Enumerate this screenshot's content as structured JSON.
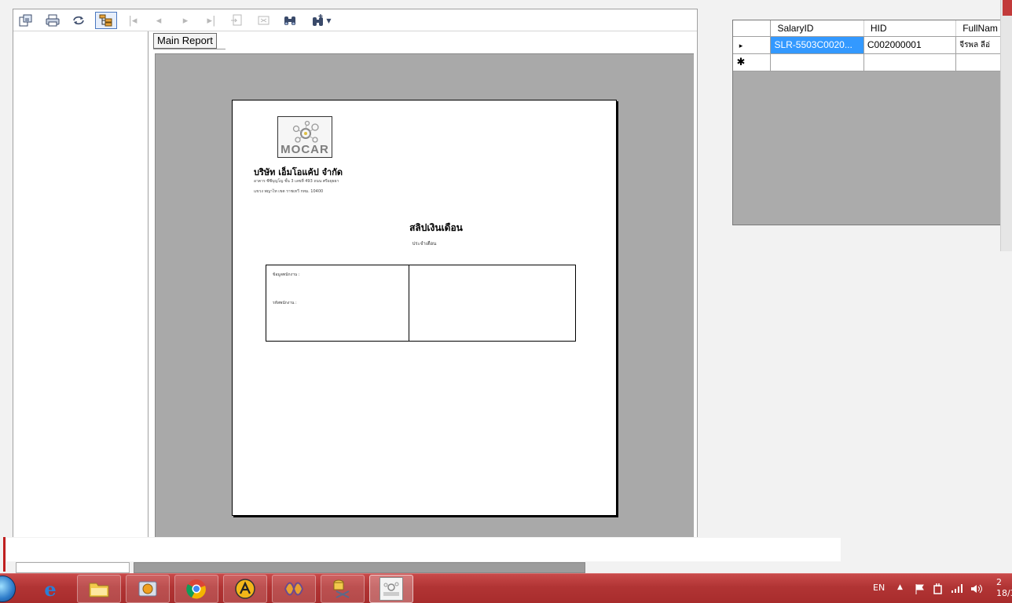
{
  "toolbar": {
    "buttons": [
      {
        "name": "export",
        "icon": "export-icon",
        "enabled": true
      },
      {
        "name": "print",
        "icon": "printer-icon",
        "enabled": true
      },
      {
        "name": "refresh",
        "icon": "refresh-icon",
        "enabled": true
      },
      {
        "name": "toggle-group-tree",
        "icon": "group-tree-icon",
        "enabled": true,
        "active": true
      },
      {
        "name": "first-page",
        "icon": "first-page-icon",
        "enabled": false
      },
      {
        "name": "previous-page",
        "icon": "previous-page-icon",
        "enabled": false
      },
      {
        "name": "next-page",
        "icon": "next-page-icon",
        "enabled": false
      },
      {
        "name": "last-page",
        "icon": "last-page-icon",
        "enabled": false
      },
      {
        "name": "goto-page",
        "icon": "goto-page-icon",
        "enabled": false
      },
      {
        "name": "close-view",
        "icon": "close-view-icon",
        "enabled": false
      },
      {
        "name": "find",
        "icon": "binoculars-icon",
        "enabled": true
      },
      {
        "name": "zoom",
        "icon": "zoom-icon",
        "enabled": true
      }
    ]
  },
  "report": {
    "tab_label": "Main Report",
    "logo_text": "MOCAR",
    "company_name": "บริษัท เอ็มโอแค้ป จำกัด",
    "address_line1": "อาคาร ซีซีบุญโญ ชั้น 3 เลขที่ 493 ถนน ศรีอยุธยา",
    "address_line2": "แขวง พญาไท เขต ราชเทวี กทม. 10400",
    "slip_title": "สลิปเงินเดือน",
    "slip_subtitle": "ประจำเดือน",
    "employee_info_label": "ข้อมูลพนักงาน :",
    "employee_code_label": "รหัสพนักงาน :"
  },
  "grid": {
    "columns": [
      "SalaryID",
      "HID",
      "FullNam"
    ],
    "rows": [
      {
        "marker": "▸",
        "SalaryID": "SLR-5503C0020...",
        "HID": "C002000001",
        "FullName": "จีรพล ลีอ่"
      }
    ],
    "new_row_marker": "✱"
  },
  "taskbar": {
    "items": [
      {
        "name": "internet-explorer",
        "icon": "internet-explorer-icon"
      },
      {
        "name": "file-explorer",
        "icon": "folder-icon"
      },
      {
        "name": "media-player",
        "icon": "media-player-icon"
      },
      {
        "name": "chrome",
        "icon": "chrome-icon"
      },
      {
        "name": "app-a",
        "icon": "circle-a-icon"
      },
      {
        "name": "visual-studio",
        "icon": "visual-studio-icon"
      },
      {
        "name": "database-tool",
        "icon": "database-tool-icon"
      },
      {
        "name": "mocar-app",
        "icon": "mocar-app-icon"
      }
    ],
    "language": "EN",
    "clock_line1": "2",
    "clock_line2": "18/3"
  }
}
